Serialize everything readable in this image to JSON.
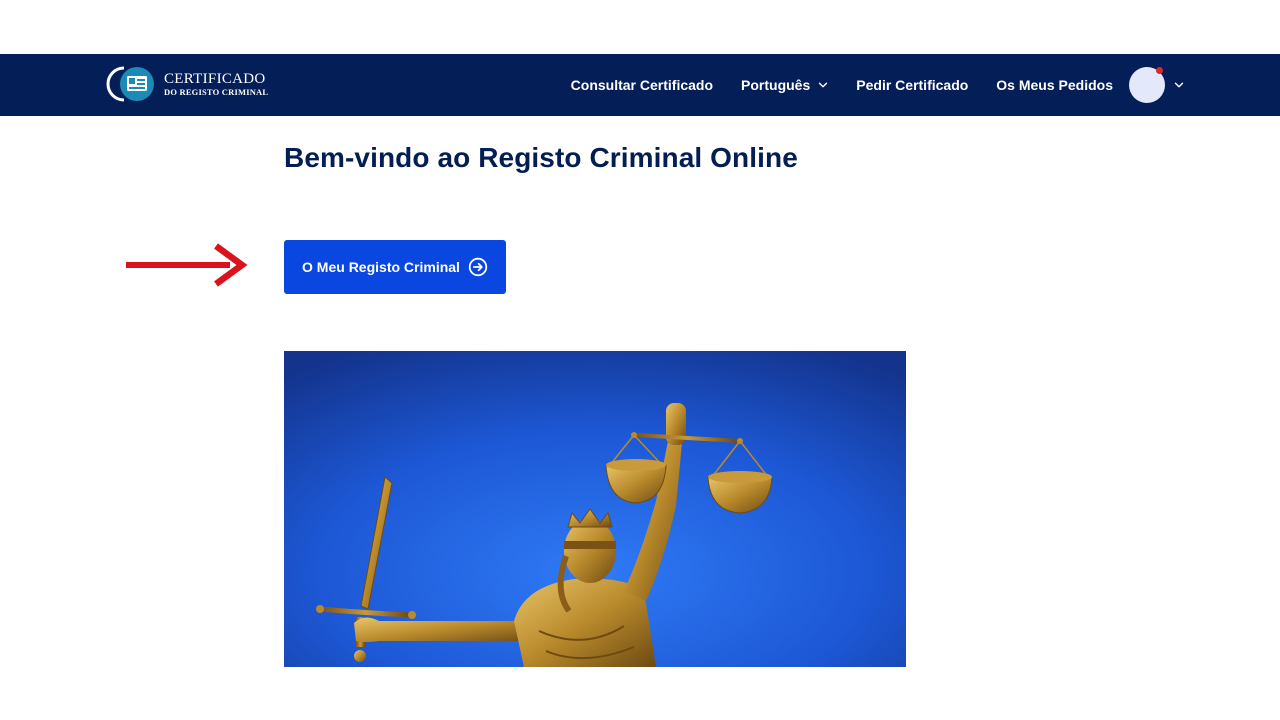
{
  "header": {
    "logo": {
      "line1": "CERTIFICADO",
      "line2": "DO REGISTO CRIMINAL"
    },
    "nav": {
      "consultar": "Consultar Certificado",
      "language": "Português",
      "pedir": "Pedir Certificado",
      "pedidos": "Os Meus Pedidos"
    },
    "avatar_has_notification": true
  },
  "main": {
    "title": "Bem-vindo ao Registo Criminal Online",
    "cta_label": "O Meu Registo Criminal",
    "cta_icon": "arrow-right-circle-icon",
    "hero_image": "statue-of-justice-image"
  },
  "colors": {
    "navbar_bg": "#041e57",
    "title_text": "#031e52",
    "cta_bg": "#0a47e0",
    "annotation_arrow": "#d9121b"
  }
}
